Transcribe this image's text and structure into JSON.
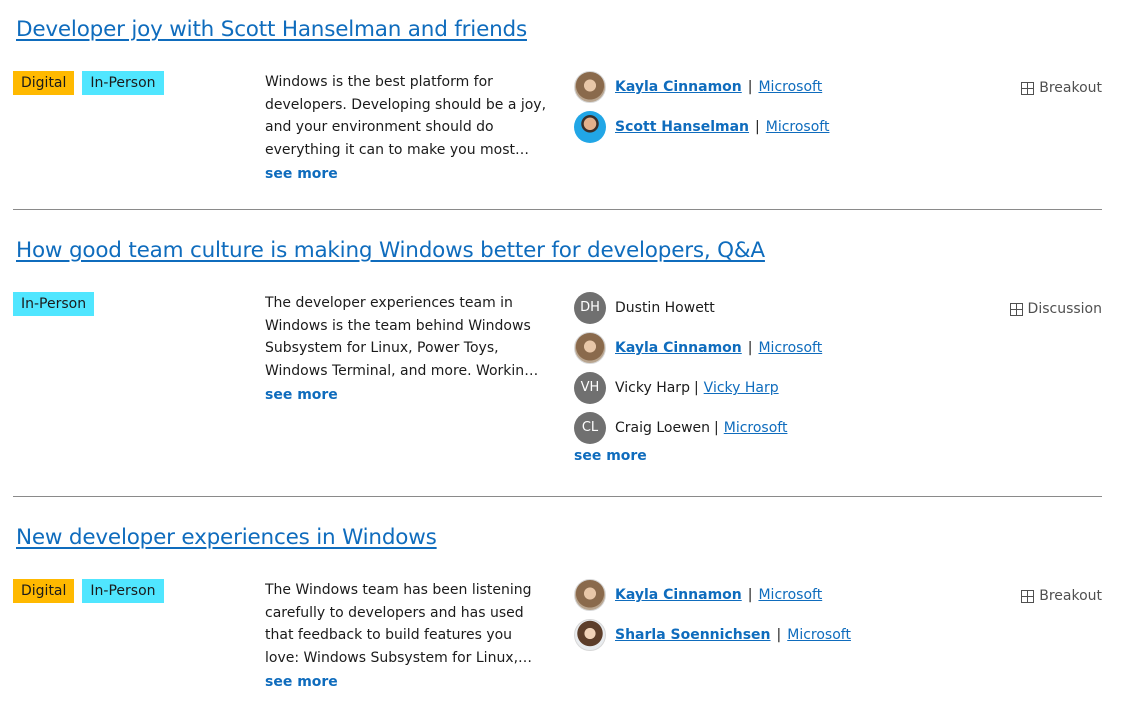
{
  "sessions": [
    {
      "title": "Developer joy with Scott Hanselman and friends",
      "tags": [
        "Digital",
        "In-Person"
      ],
      "description": "Windows is the best platform for developers. Developing should be a joy, and your environment should do everything it can to make you most productive.",
      "see_more": "see more",
      "type": "Breakout",
      "speakers": [
        {
          "name": "Kayla Cinnamon",
          "separator": "|",
          "company": "Microsoft",
          "avatar": "photo"
        },
        {
          "name": "Scott Hanselman",
          "separator": "|",
          "company": "Microsoft",
          "avatar": "photo"
        }
      ]
    },
    {
      "title": "How good team culture is making Windows better for developers, Q&A",
      "tags": [
        "In-Person"
      ],
      "description": "The developer experiences team in Windows is the team behind Windows Subsystem for Linux, Power Toys, Windows Terminal, and more. Working in the open with the community.",
      "see_more": "see more",
      "type": "Discussion",
      "speakers": [
        {
          "name": "Dustin Howett",
          "initials": "DH"
        },
        {
          "name": "Kayla Cinnamon",
          "separator": "|",
          "company": "Microsoft",
          "avatar": "photo"
        },
        {
          "name": "Vicky Harp",
          "separator": "|",
          "company": "Vicky Harp",
          "initials": "VH"
        },
        {
          "name": "Craig Loewen",
          "separator": "|",
          "company": "Microsoft",
          "initials": "CL"
        }
      ],
      "speakers_see_more": "see more"
    },
    {
      "title": "New developer experiences in Windows",
      "tags": [
        "Digital",
        "In-Person"
      ],
      "description": "The Windows team has been listening carefully to developers and has used that feedback to build features you love: Windows Subsystem for Linux, Windows Terminal and more.",
      "see_more": "see more",
      "type": "Breakout",
      "speakers": [
        {
          "name": "Kayla Cinnamon",
          "separator": "|",
          "company": "Microsoft",
          "avatar": "photo"
        },
        {
          "name": "Sharla Soennichsen",
          "separator": "|",
          "company": "Microsoft",
          "avatar": "photo"
        }
      ]
    }
  ],
  "icons": {
    "session_type": "grid-icon"
  },
  "colors": {
    "link": "#0f6cbd",
    "tag_digital": "#ffb900",
    "tag_in_person": "#50e6ff",
    "divider": "#8a8a8a"
  }
}
